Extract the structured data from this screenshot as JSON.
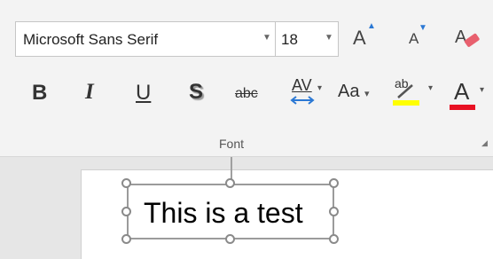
{
  "font": {
    "name": "Microsoft Sans Serif",
    "size": "18",
    "group_label": "Font"
  },
  "buttons": {
    "grow": "A",
    "shrink": "A",
    "bold": "B",
    "italic": "I",
    "underline": "U",
    "shadow": "S",
    "strikethrough": "abc",
    "char_spacing": "AV",
    "change_case": "Aa",
    "highlight": "ab",
    "font_color": "A"
  },
  "colors": {
    "highlight": "#ffff00",
    "font_color": "#e81123",
    "accent": "#2b78d4"
  },
  "slide": {
    "text": "This is a test"
  }
}
